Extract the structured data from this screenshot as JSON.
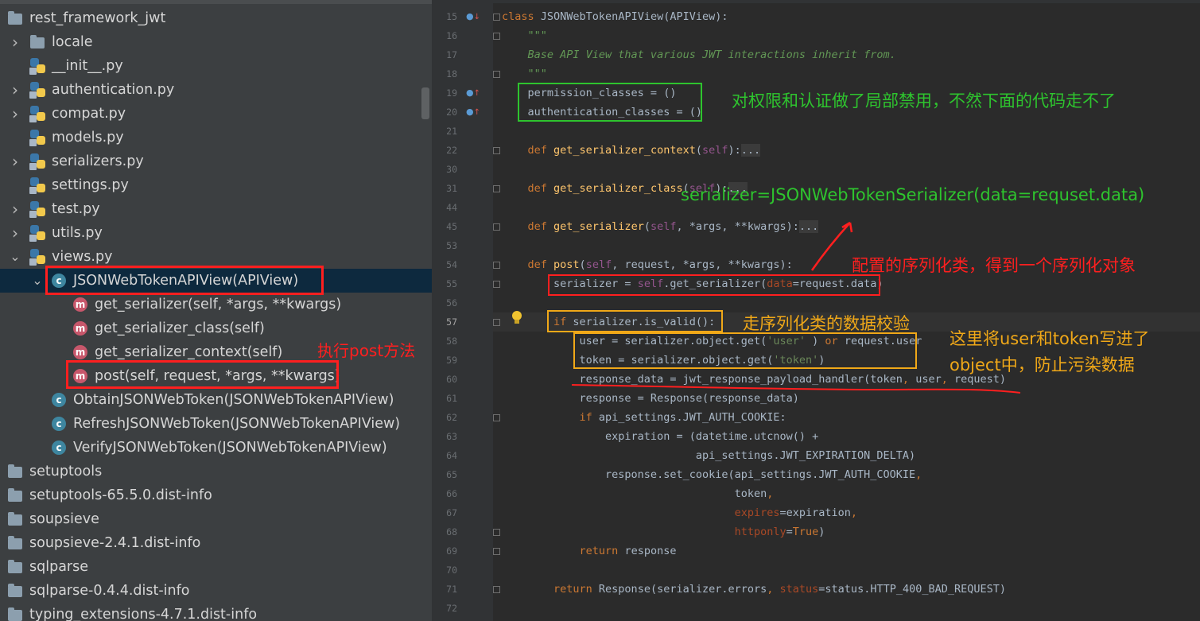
{
  "project_tree": {
    "items": [
      {
        "name": "rest_framework_jwt",
        "icon": "folder-icon",
        "expanded": true
      },
      {
        "name": "locale",
        "icon": "folder-icon",
        "arrow": "›"
      },
      {
        "name": "__init__.py",
        "icon": "python-file-icon"
      },
      {
        "name": "authentication.py",
        "icon": "python-file-icon",
        "arrow": "›"
      },
      {
        "name": "compat.py",
        "icon": "python-file-icon",
        "arrow": "›"
      },
      {
        "name": "models.py",
        "icon": "python-file-icon"
      },
      {
        "name": "serializers.py",
        "icon": "python-file-icon",
        "arrow": "›"
      },
      {
        "name": "settings.py",
        "icon": "python-file-icon"
      },
      {
        "name": "test.py",
        "icon": "python-file-icon",
        "arrow": "›"
      },
      {
        "name": "utils.py",
        "icon": "python-file-icon",
        "arrow": "›"
      },
      {
        "name": "views.py",
        "icon": "python-file-icon",
        "arrow": "⌄"
      },
      {
        "name": "JSONWebTokenAPIView(APIView)",
        "icon": "class-icon",
        "arrow": "⌄",
        "selected": true
      },
      {
        "name": "get_serializer(self, *args, **kwargs)",
        "icon": "method-icon"
      },
      {
        "name": "get_serializer_class(self)",
        "icon": "method-icon"
      },
      {
        "name": "get_serializer_context(self)",
        "icon": "method-icon"
      },
      {
        "name": "post(self, request, *args, **kwargs)",
        "icon": "method-icon"
      },
      {
        "name": "ObtainJSONWebToken(JSONWebTokenAPIView)",
        "icon": "class-icon"
      },
      {
        "name": "RefreshJSONWebToken(JSONWebTokenAPIView)",
        "icon": "class-icon"
      },
      {
        "name": "VerifyJSONWebToken(JSONWebTokenAPIView)",
        "icon": "class-icon"
      },
      {
        "name": "setuptools",
        "icon": "folder-icon"
      },
      {
        "name": "setuptools-65.5.0.dist-info",
        "icon": "folder-icon"
      },
      {
        "name": "soupsieve",
        "icon": "folder-icon"
      },
      {
        "name": "soupsieve-2.4.1.dist-info",
        "icon": "folder-icon"
      },
      {
        "name": "sqlparse",
        "icon": "folder-icon"
      },
      {
        "name": "sqlparse-0.4.4.dist-info",
        "icon": "folder-icon"
      },
      {
        "name": "typing_extensions-4.7.1.dist-info",
        "icon": "folder-icon"
      }
    ]
  },
  "editor": {
    "current_line": "57",
    "lines": [
      {
        "n": "15",
        "t": [
          [
            "kw",
            "class "
          ],
          [
            "",
            "JSONWebTokenAPIView(APIView):"
          ]
        ]
      },
      {
        "n": "16",
        "t": [
          [
            "doc",
            "    \"\"\""
          ]
        ]
      },
      {
        "n": "17",
        "t": [
          [
            "doc",
            "    Base API View that various JWT interactions inherit from."
          ]
        ]
      },
      {
        "n": "18",
        "t": [
          [
            "doc",
            "    \"\"\""
          ]
        ]
      },
      {
        "n": "19",
        "t": [
          [
            "",
            "    permission_classes = ()"
          ]
        ]
      },
      {
        "n": "20",
        "t": [
          [
            "",
            "    authentication_classes = ()"
          ]
        ]
      },
      {
        "n": "21",
        "t": []
      },
      {
        "n": "22",
        "t": [
          [
            "kw",
            "    def "
          ],
          [
            "fn",
            "get_serializer_context"
          ],
          [
            "",
            "("
          ],
          [
            "self",
            "self"
          ],
          [
            "",
            "):"
          ],
          [
            "fd",
            "..."
          ]
        ]
      },
      {
        "n": "30",
        "t": []
      },
      {
        "n": "31",
        "t": [
          [
            "kw",
            "    def "
          ],
          [
            "fn",
            "get_serializer_class"
          ],
          [
            "",
            "("
          ],
          [
            "self",
            "self"
          ],
          [
            "",
            "):"
          ],
          [
            "fd",
            "..."
          ]
        ]
      },
      {
        "n": "44",
        "t": []
      },
      {
        "n": "45",
        "t": [
          [
            "kw",
            "    def "
          ],
          [
            "fn",
            "get_serializer"
          ],
          [
            "",
            "("
          ],
          [
            "self",
            "self"
          ],
          [
            "",
            ", *args, **kwargs):"
          ],
          [
            "fd",
            "..."
          ]
        ]
      },
      {
        "n": "53",
        "t": []
      },
      {
        "n": "54",
        "t": [
          [
            "kw",
            "    def "
          ],
          [
            "fn",
            "post"
          ],
          [
            "",
            "("
          ],
          [
            "self",
            "self"
          ],
          [
            "",
            ", request, *args, **kwargs):"
          ]
        ]
      },
      {
        "n": "55",
        "t": [
          [
            "",
            "        serializer = "
          ],
          [
            "self",
            "self"
          ],
          [
            "",
            ".get_serializer("
          ],
          [
            "prm",
            "data"
          ],
          [
            "",
            "=request.data)"
          ]
        ]
      },
      {
        "n": "56",
        "t": []
      },
      {
        "n": "57",
        "t": [
          [
            "kw",
            "        if "
          ],
          [
            "",
            "serializer.is_valid():"
          ]
        ]
      },
      {
        "n": "58",
        "t": [
          [
            "",
            "            user = serializer.object.get("
          ],
          [
            "str",
            "'user'"
          ],
          [
            "",
            " ) "
          ],
          [
            "kw",
            "or "
          ],
          [
            "",
            "request.user"
          ]
        ]
      },
      {
        "n": "59",
        "t": [
          [
            "",
            "            token = serializer.object.get("
          ],
          [
            "str",
            "'token'"
          ],
          [
            "",
            ")"
          ]
        ]
      },
      {
        "n": "60",
        "t": [
          [
            "",
            "            response_data = jwt_response_payload_handler(token"
          ],
          [
            "kw",
            ", "
          ],
          [
            "",
            "user"
          ],
          [
            "kw",
            ", "
          ],
          [
            "",
            "request)"
          ]
        ]
      },
      {
        "n": "61",
        "t": [
          [
            "",
            "            response = Response(response_data)"
          ]
        ]
      },
      {
        "n": "62",
        "t": [
          [
            "kw",
            "            if "
          ],
          [
            "",
            "api_settings.JWT_AUTH_COOKIE:"
          ]
        ]
      },
      {
        "n": "63",
        "t": [
          [
            "",
            "                expiration = (datetime.utcnow() +"
          ]
        ]
      },
      {
        "n": "64",
        "t": [
          [
            "",
            "                              api_settings.JWT_EXPIRATION_DELTA)"
          ]
        ]
      },
      {
        "n": "65",
        "t": [
          [
            "",
            "                response.set_cookie(api_settings.JWT_AUTH_COOKIE"
          ],
          [
            "kw",
            ","
          ]
        ]
      },
      {
        "n": "66",
        "t": [
          [
            "",
            "                                    token"
          ],
          [
            "kw",
            ","
          ]
        ]
      },
      {
        "n": "67",
        "t": [
          [
            "prm",
            "                                    expires"
          ],
          [
            "",
            "=expiration"
          ],
          [
            "kw",
            ","
          ]
        ]
      },
      {
        "n": "68",
        "t": [
          [
            "prm",
            "                                    httponly"
          ],
          [
            "",
            "="
          ],
          [
            "kw",
            "True"
          ],
          [
            "",
            ")"
          ]
        ]
      },
      {
        "n": "69",
        "t": [
          [
            "kw",
            "            return "
          ],
          [
            "",
            "response"
          ]
        ]
      },
      {
        "n": "70",
        "t": []
      },
      {
        "n": "71",
        "t": [
          [
            "kw",
            "        return "
          ],
          [
            "",
            "Response(serializer.errors"
          ],
          [
            "kw",
            ", "
          ],
          [
            "prm",
            "status"
          ],
          [
            "",
            "=status.HTTP_400_BAD_REQUEST)"
          ]
        ]
      },
      {
        "n": "72",
        "t": []
      }
    ]
  },
  "annotations": {
    "disable_auth": "对权限和认证做了局部禁用，不然下面的代码走不了",
    "serializer_expr": "serializer=JSONWebTokenSerializer(data=requset.data)",
    "configured_serializer": "配置的序列化类，得到一个序列化对象",
    "validate": "走序列化类的数据校验",
    "write_object_1": "这里将user和token写进了",
    "write_object_2": "object中，防止污染数据",
    "exec_post": "执行post方法"
  },
  "colors": {
    "red": "#ff1f1f",
    "green": "#2ec42e",
    "orange": "#f0a818",
    "selection": "#0d293e",
    "editor_bg": "#2b2b2b",
    "tree_bg": "#3c3f41"
  }
}
